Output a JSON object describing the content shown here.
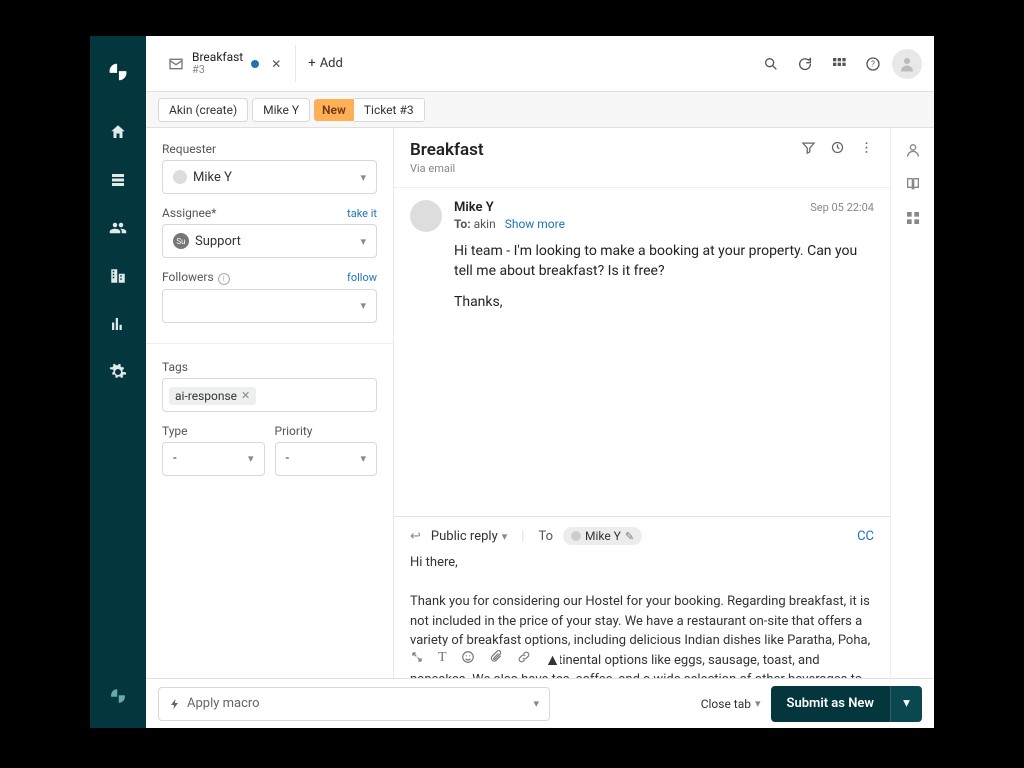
{
  "tab": {
    "title": "Breakfast",
    "sub": "#3",
    "add_label": "Add"
  },
  "breadcrumb": {
    "creator": "Akin (create)",
    "user": "Mike Y",
    "badge": "New",
    "ticket": "Ticket #3"
  },
  "left": {
    "requester_label": "Requester",
    "requester_value": "Mike Y",
    "assignee_label": "Assignee*",
    "assignee_link": "take it",
    "assignee_value": "Support",
    "followers_label": "Followers",
    "followers_link": "follow",
    "followers_value": "",
    "tags_label": "Tags",
    "tags": [
      "ai-response"
    ],
    "type_label": "Type",
    "type_value": "-",
    "priority_label": "Priority",
    "priority_value": "-"
  },
  "ticket": {
    "title": "Breakfast",
    "via": "Via email"
  },
  "message": {
    "author": "Mike Y",
    "time": "Sep 05 22:04",
    "to_label": "To:",
    "to_value": "akin",
    "show_more": "Show more",
    "body_p1": "Hi team - I'm looking to make a booking at your property. Can you tell me about breakfast? Is it free?",
    "body_p2": "Thanks,"
  },
  "reply": {
    "type": "Public reply",
    "to_label": "To",
    "to_chip": "Mike Y",
    "cc": "CC",
    "body_p1": "Hi there,",
    "body_p2": "Thank you for considering our Hostel for your booking. Regarding breakfast, it is not included in the price of your stay. We have a restaurant on-site that offers a variety of breakfast options, including delicious Indian dishes like Paratha, Poha, and Upma, as well as Continental options like eggs, sausage, toast, and pancakes. We also have tea, coffee, and a wide selection of other beverages to start your day right. You can find the prices for breakfast on our menu."
  },
  "footer": {
    "macro_placeholder": "Apply macro",
    "close_tab": "Close tab",
    "submit": "Submit as New"
  }
}
